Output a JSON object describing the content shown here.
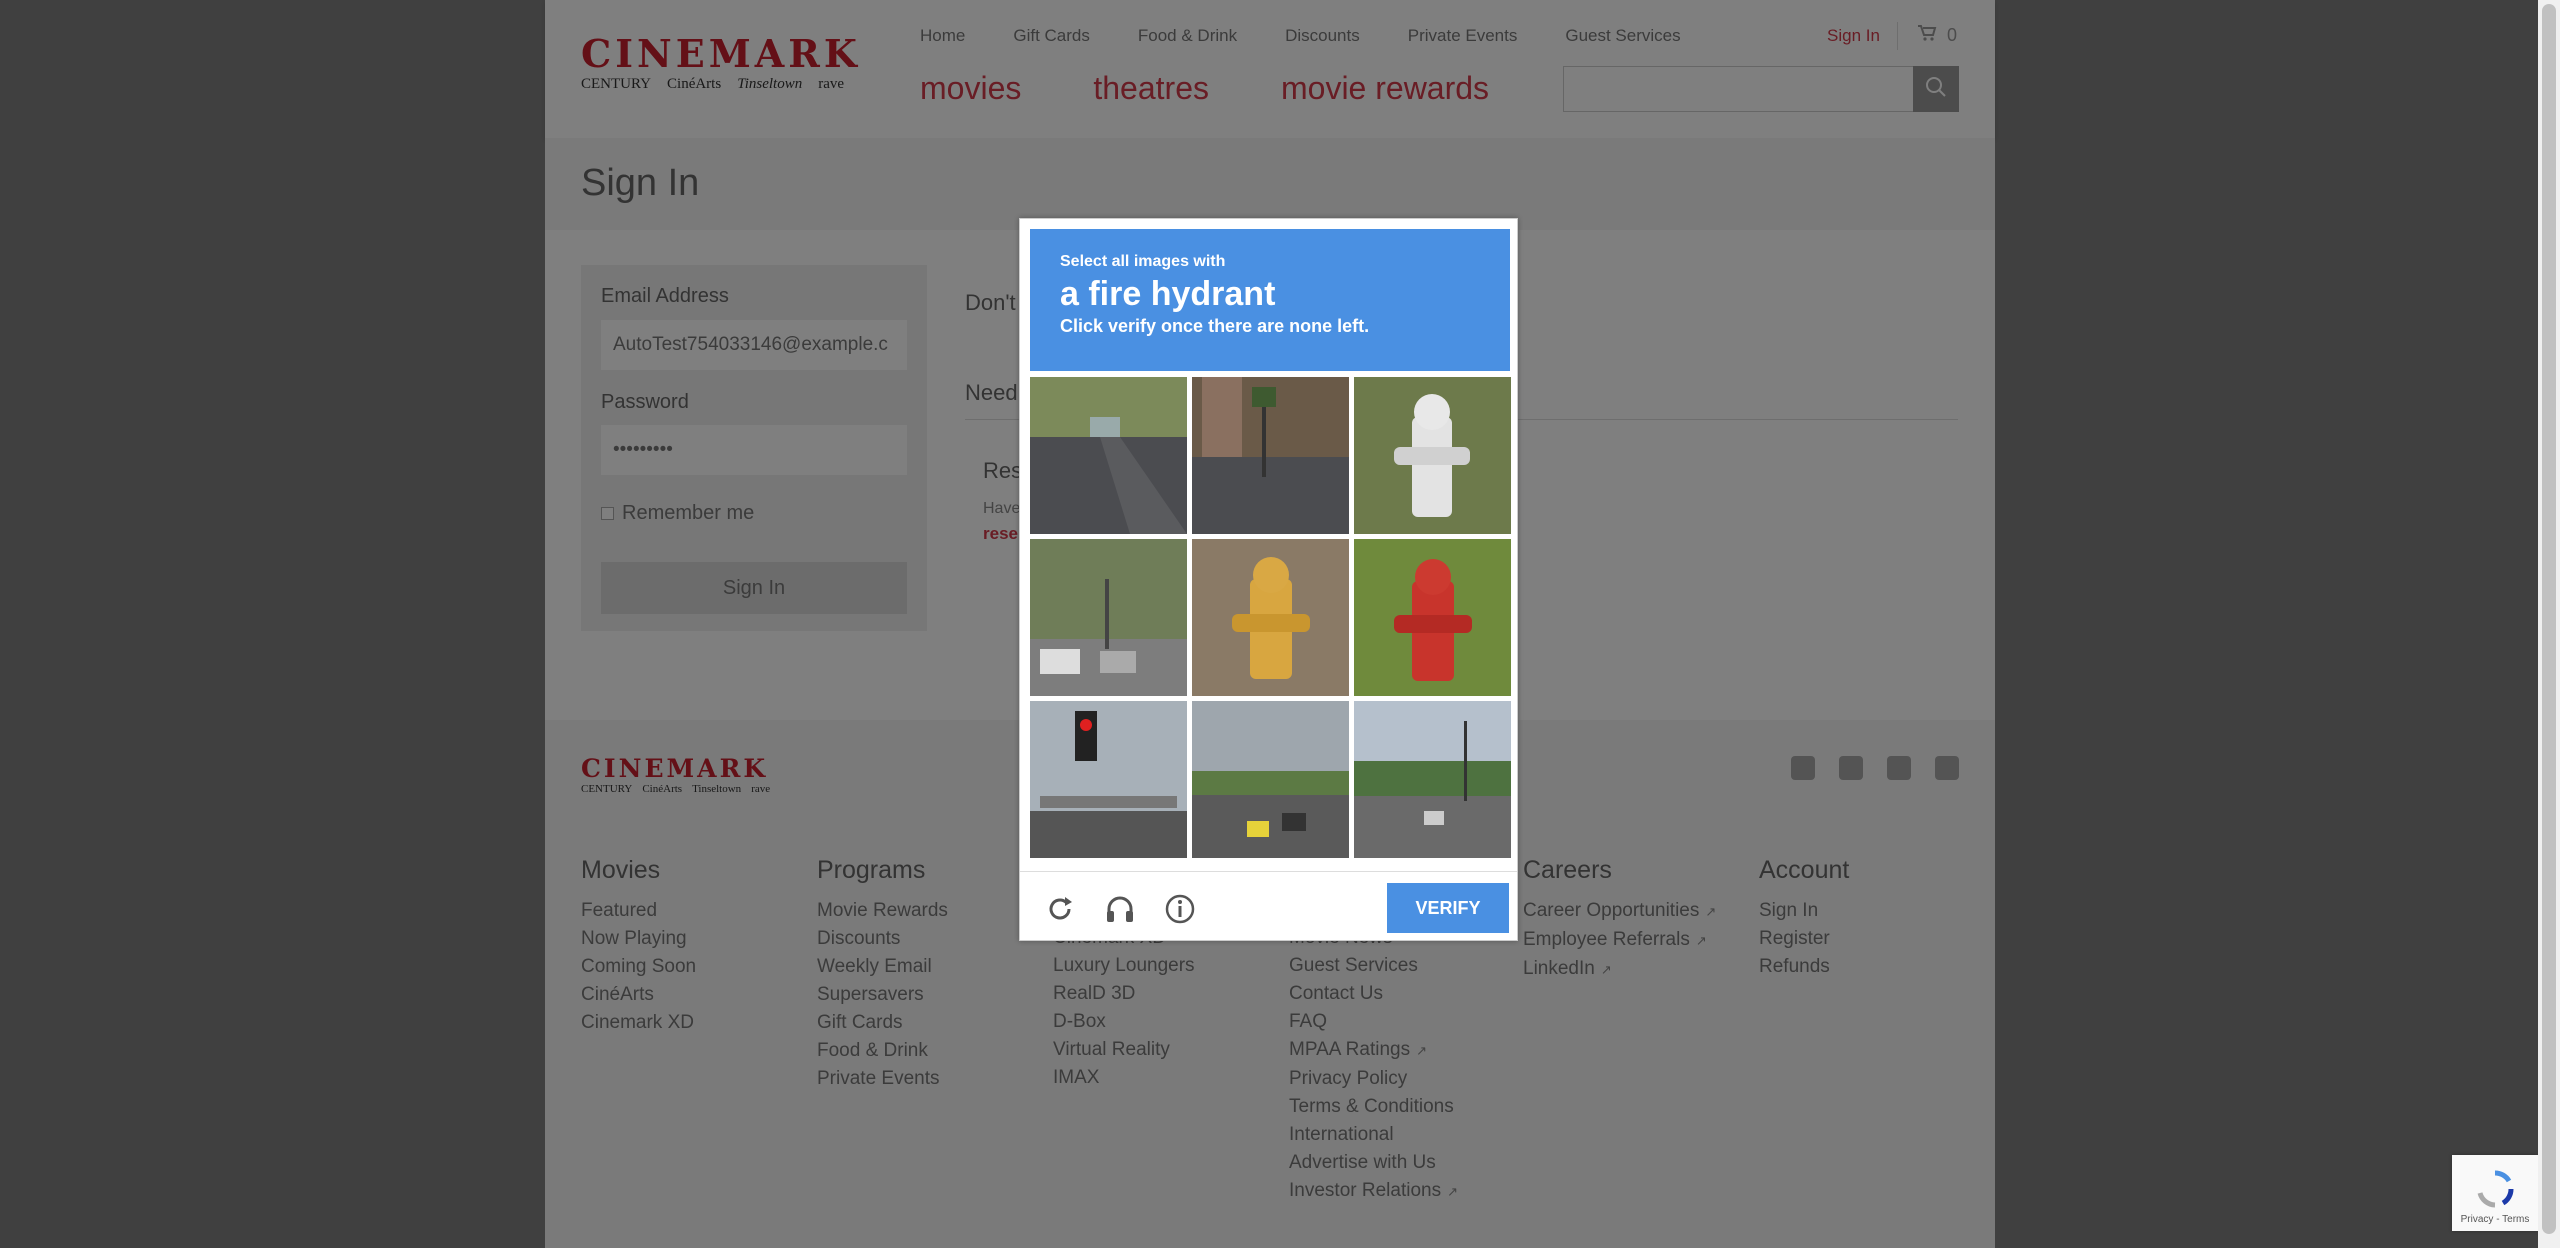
{
  "header": {
    "logo": {
      "main": "CINEMARK",
      "sub": [
        "CENTURY",
        "CinéArts",
        "Tinseltown",
        "rave"
      ]
    },
    "top_nav": [
      "Home",
      "Gift Cards",
      "Food & Drink",
      "Discounts",
      "Private Events",
      "Guest Services"
    ],
    "sign_in": "Sign In",
    "cart_count": "0",
    "main_nav": [
      "movies",
      "theatres",
      "movie rewards"
    ],
    "search_placeholder": ""
  },
  "page_title": "Sign In",
  "form": {
    "email_label": "Email Address",
    "email_value": "AutoTest754033146@example.c",
    "password_label": "Password",
    "password_value": "•••••••••",
    "remember_label": "Remember me",
    "submit_label": "Sign In"
  },
  "right_fragments": {
    "dont": "Don't",
    "need": "Need",
    "res": "Res",
    "have": "Have",
    "rese": "rese"
  },
  "captcha": {
    "instruction_small": "Select all images with",
    "target": "a fire hydrant",
    "instruction_sub": "Click verify once there are none left.",
    "verify_label": "VERIFY",
    "accent": "#4a90e2"
  },
  "footer": {
    "logo": {
      "main": "CINEMARK",
      "sub": [
        "CENTURY",
        "CinéArts",
        "Tinseltown",
        "rave"
      ]
    },
    "columns": [
      {
        "head": "Movies",
        "links": [
          "Featured",
          "Now Playing",
          "Coming Soon",
          "CinéArts",
          "Cinemark XD"
        ]
      },
      {
        "head": "Programs",
        "links": [
          "Movie Rewards",
          "Discounts",
          "Weekly Email",
          "Supersavers",
          "Gift Cards",
          "Food & Drink",
          "Private Events"
        ]
      },
      {
        "head": "",
        "links": [
          "Cinemark XD",
          "Luxury Loungers",
          "RealD 3D",
          "D-Box",
          "Virtual Reality",
          "IMAX"
        ]
      },
      {
        "head": "",
        "links": [
          "Movie News",
          "Guest Services",
          "Contact Us",
          "FAQ",
          "MPAA Ratings",
          "Privacy Policy",
          "Terms & Conditions",
          "International",
          "Advertise with Us",
          "Investor Relations"
        ]
      },
      {
        "head": "Careers",
        "links": [
          "Career Opportunities",
          "Employee Referrals",
          "LinkedIn"
        ]
      },
      {
        "head": "Account",
        "links": [
          "Sign In",
          "Register",
          "Refunds"
        ]
      }
    ]
  },
  "recaptcha_badge": "Privacy - Terms",
  "colors": {
    "brand": "#c8202f",
    "link_red": "#d23b4a"
  }
}
